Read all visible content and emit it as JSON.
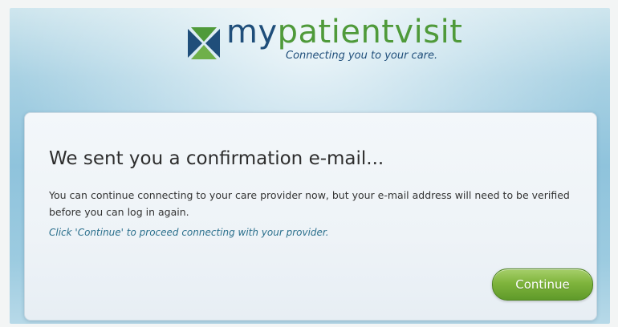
{
  "brand": {
    "name_prefix": "my",
    "name_rest": "patientvisit",
    "tagline": "Connecting you to your care.",
    "colors": {
      "navy": "#1f4e7a",
      "green": "#4f9a3a"
    }
  },
  "dialog": {
    "title": "We sent you a confirmation e-mail...",
    "message": "You can continue connecting to your care provider now, but your e-mail address will need to be verified before you can log in again.",
    "hint": "Click 'Continue' to proceed connecting with your provider.",
    "continue_label": "Continue"
  }
}
